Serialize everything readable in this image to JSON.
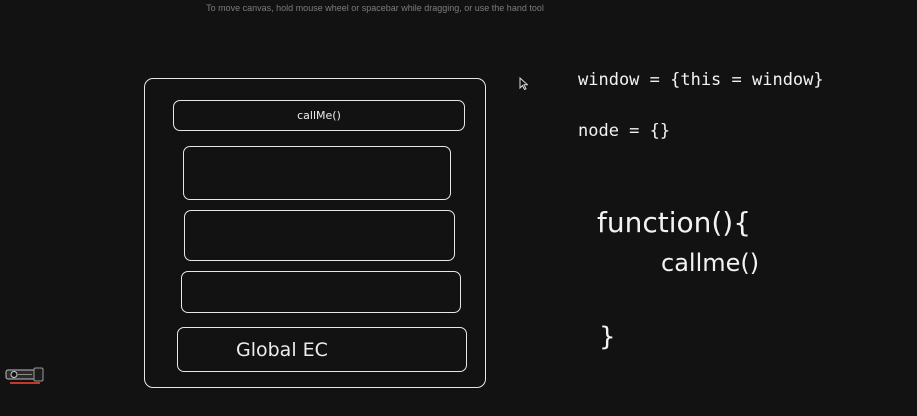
{
  "hint_text": "To move canvas, hold mouse wheel or spacebar while dragging, or use the hand tool",
  "stack": {
    "frames": [
      {
        "label": "callMe()"
      },
      {
        "label": ""
      },
      {
        "label": ""
      },
      {
        "label": ""
      },
      {
        "label": "Global EC"
      }
    ]
  },
  "notes": {
    "window": "window = {this = window}",
    "node": "node = {}"
  },
  "code": {
    "line1": "function(){",
    "line2": "callme()",
    "line3": "}"
  },
  "icons": {
    "cursor": "mouse-pointer-icon",
    "tool": "pen-tool-icon"
  },
  "colors": {
    "background": "#121212",
    "stroke": "#e6e6e6",
    "accent": "#c0392b"
  }
}
